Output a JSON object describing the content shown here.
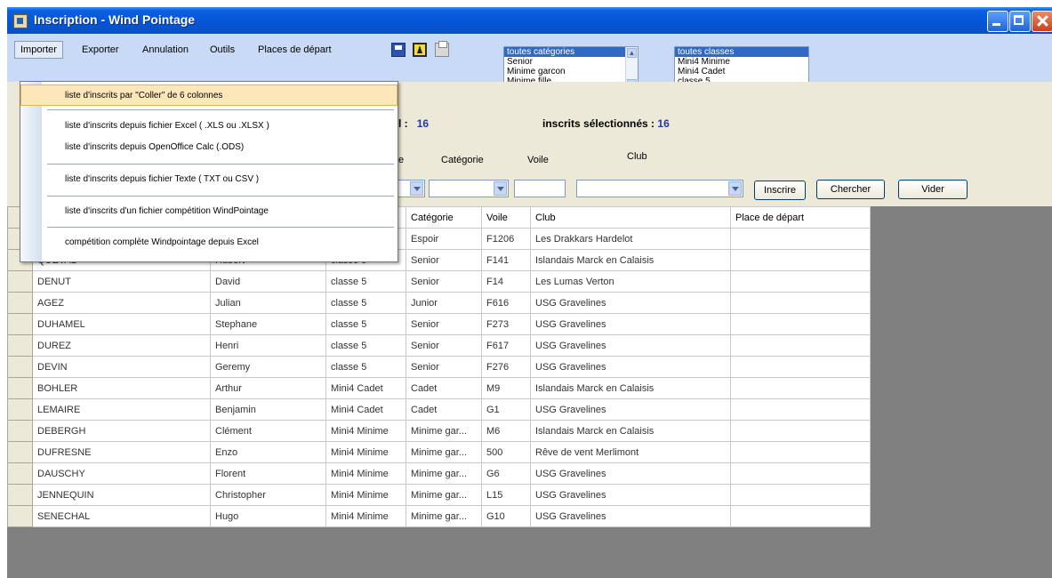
{
  "window": {
    "title": "Inscription - Wind Pointage"
  },
  "menu": {
    "items": [
      "Importer",
      "Exporter",
      "Annulation",
      "Outils",
      "Places de départ"
    ],
    "active_index": 0
  },
  "toolbar_icons": [
    "save-icon",
    "upload-arrow-icon",
    "print-icon"
  ],
  "categories_list": {
    "options": [
      "toutes catégories",
      "Senior",
      "Minime garcon",
      "Minime fille"
    ],
    "selected_index": 0
  },
  "classes_list": {
    "options": [
      "toutes classes",
      "Mini4 Minime",
      "Mini4 Cadet",
      "classe 5"
    ],
    "selected_index": 0
  },
  "info": {
    "total_label": "l :",
    "total_value": "16",
    "selected_label": "inscrits sélectionnés :",
    "selected_value": "16"
  },
  "filters": {
    "e_label": "e",
    "categorie_label": "Catégorie",
    "voile_label": "Voile",
    "club_label": "Club"
  },
  "buttons": {
    "inscrire": "Inscrire",
    "chercher": "Chercher",
    "vider": "Vider"
  },
  "import_menu": {
    "items": [
      "liste d'inscrits par \"Coller\" de 6 colonnes",
      "liste d'inscrits depuis fichier Excel ( .XLS ou .XLSX )",
      "liste d'inscrits depuis OpenOffice Calc (.ODS)",
      "liste d'inscrits depuis fichier Texte ( TXT ou CSV )",
      "liste d'inscrits d'un fichier compétition WindPointage",
      "compétition complète Windpointage depuis Excel"
    ],
    "highlighted_index": 0
  },
  "table": {
    "headers": [
      "",
      "",
      "",
      "",
      "Catégorie",
      "Voile",
      "Club",
      "Place de départ"
    ],
    "rows": [
      [
        "",
        "",
        "",
        "5",
        "Espoir",
        "F1206",
        "Les Drakkars Hardelot",
        ""
      ],
      [
        "",
        "QUEVAL",
        "Hubert",
        "classe 5",
        "Senior",
        "F141",
        "Islandais Marck en Calaisis",
        ""
      ],
      [
        "",
        "DENUT",
        "David",
        "classe 5",
        "Senior",
        "F14",
        "Les Lumas Verton",
        ""
      ],
      [
        "",
        "AGEZ",
        "Julian",
        "classe 5",
        "Junior",
        "F616",
        "USG Gravelines",
        ""
      ],
      [
        "",
        "DUHAMEL",
        "Stephane",
        "classe 5",
        "Senior",
        "F273",
        "USG Gravelines",
        ""
      ],
      [
        "",
        "DUREZ",
        "Henri",
        "classe 5",
        "Senior",
        "F617",
        "USG Gravelines",
        ""
      ],
      [
        "",
        "DEVIN",
        "Geremy",
        "classe 5",
        "Senior",
        "F276",
        "USG Gravelines",
        ""
      ],
      [
        "",
        "BOHLER",
        "Arthur",
        "Mini4 Cadet",
        "Cadet",
        "M9",
        "Islandais Marck en Calaisis",
        ""
      ],
      [
        "",
        "LEMAIRE",
        "Benjamin",
        "Mini4 Cadet",
        "Cadet",
        "G1",
        "USG Gravelines",
        ""
      ],
      [
        "",
        "DEBERGH",
        "Clément",
        "Mini4 Minime",
        "Minime gar...",
        "M6",
        "Islandais Marck en Calaisis",
        ""
      ],
      [
        "",
        "DUFRESNE",
        "Enzo",
        "Mini4 Minime",
        "Minime gar...",
        "500",
        "Rêve de vent Merlimont",
        ""
      ],
      [
        "",
        "DAUSCHY",
        "Florent",
        "Mini4 Minime",
        "Minime gar...",
        "G6",
        "USG Gravelines",
        ""
      ],
      [
        "",
        "JENNEQUIN",
        "Christopher",
        "Mini4 Minime",
        "Minime gar...",
        "L15",
        "USG Gravelines",
        ""
      ],
      [
        "",
        "SENECHAL",
        "Hugo",
        "Mini4 Minime",
        "Minime gar...",
        "G10",
        "USG Gravelines",
        ""
      ]
    ]
  },
  "colors": {
    "title_bar": "#0554d8",
    "menu_bar": "#c8daf5",
    "selection": "#316ac5",
    "count": "#1d3aa8",
    "highlight": "#fde7ba"
  }
}
